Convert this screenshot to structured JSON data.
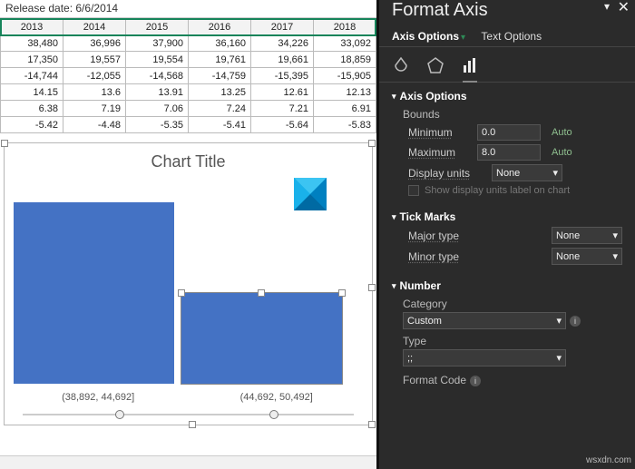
{
  "formula_bar": "Release date: 6/6/2014",
  "table": {
    "headers": [
      "2013",
      "2014",
      "2015",
      "2016",
      "2017",
      "2018"
    ],
    "rows": [
      [
        "38,480",
        "36,996",
        "37,900",
        "36,160",
        "34,226",
        "33,092"
      ],
      [
        "17,350",
        "19,557",
        "19,554",
        "19,761",
        "19,661",
        "18,859"
      ],
      [
        "-14,744",
        "-12,055",
        "-14,568",
        "-14,759",
        "-15,395",
        "-15,905"
      ],
      [
        "14.15",
        "13.6",
        "13.91",
        "13.25",
        "12.61",
        "12.13"
      ],
      [
        "6.38",
        "7.19",
        "7.06",
        "7.24",
        "7.21",
        "6.91"
      ],
      [
        "-5.42",
        "-4.48",
        "-5.35",
        "-5.41",
        "-5.64",
        "-5.83"
      ]
    ]
  },
  "chart": {
    "title": "Chart Title",
    "xlabels": [
      "(38,892, 44,692]",
      "(44,692, 50,492]"
    ]
  },
  "chart_data": {
    "type": "bar",
    "title": "Chart Title",
    "categories": [
      "(38,892, 44,692]",
      "(44,692, 50,492]"
    ],
    "values": [
      2,
      1
    ],
    "xlabel": "",
    "ylabel": "",
    "ylim": [
      0,
      2
    ]
  },
  "panel": {
    "title": "Format Axis",
    "tabs": {
      "axis_options": "Axis Options",
      "text_options": "Text Options"
    },
    "sections": {
      "axis_options": {
        "heading": "Axis Options",
        "bounds_label": "Bounds",
        "min_label": "Minimum",
        "min_value": "0.0",
        "min_auto": "Auto",
        "max_label": "Maximum",
        "max_value": "8.0",
        "max_auto": "Auto",
        "display_units_label": "Display units",
        "display_units_value": "None",
        "show_units_chk": "Show display units label on chart"
      },
      "tick_marks": {
        "heading": "Tick Marks",
        "major_label": "Major type",
        "major_value": "None",
        "minor_label": "Minor type",
        "minor_value": "None"
      },
      "number": {
        "heading": "Number",
        "category_label": "Category",
        "category_value": "Custom",
        "type_label": "Type",
        "type_value": ";;",
        "format_code_label": "Format Code"
      }
    }
  },
  "watermark": "wsxdn.com"
}
